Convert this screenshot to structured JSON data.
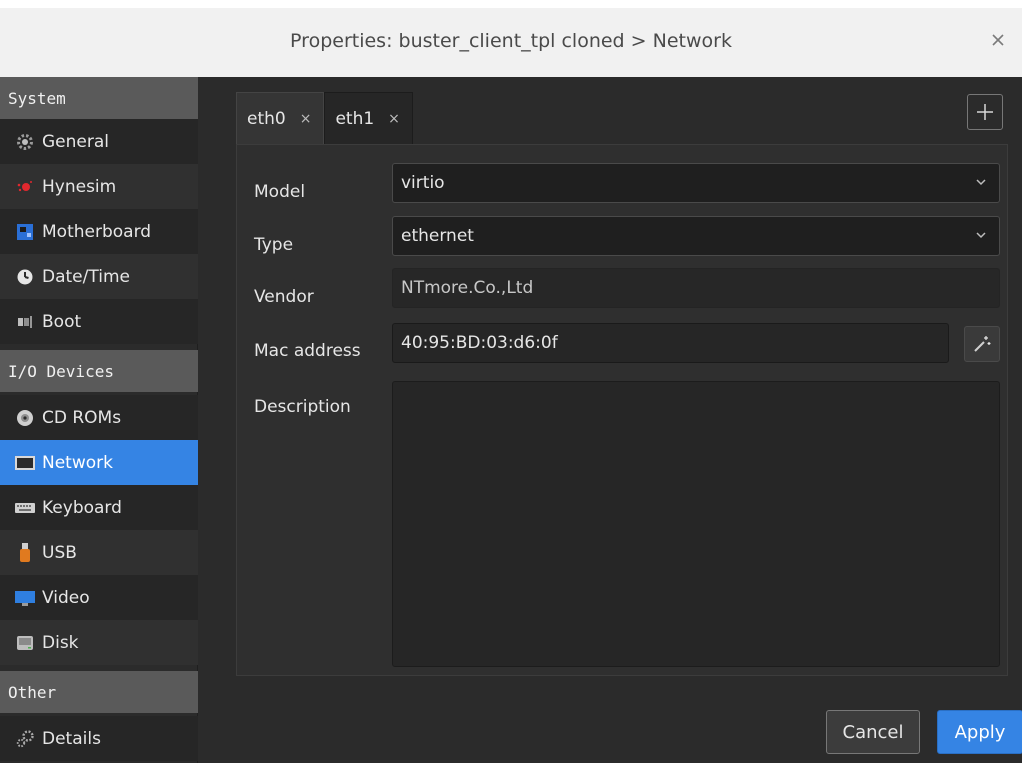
{
  "window": {
    "title": "Properties: buster_client_tpl cloned > Network",
    "close_symbol": "×"
  },
  "sidebar": {
    "sections": [
      {
        "header": "System",
        "items": [
          {
            "label": "General",
            "icon": "gear-icon"
          },
          {
            "label": "Hynesim",
            "icon": "hynesim-icon"
          },
          {
            "label": "Motherboard",
            "icon": "motherboard-icon"
          },
          {
            "label": "Date/Time",
            "icon": "clock-icon"
          },
          {
            "label": "Boot",
            "icon": "boot-icon"
          }
        ]
      },
      {
        "header": "I/O Devices",
        "items": [
          {
            "label": "CD ROMs",
            "icon": "cdrom-icon"
          },
          {
            "label": "Network",
            "icon": "network-icon",
            "selected": true
          },
          {
            "label": "Keyboard",
            "icon": "keyboard-icon"
          },
          {
            "label": "USB",
            "icon": "usb-icon"
          },
          {
            "label": "Video",
            "icon": "video-icon"
          },
          {
            "label": "Disk",
            "icon": "disk-icon"
          }
        ]
      },
      {
        "header": "Other",
        "items": [
          {
            "label": "Details",
            "icon": "details-gear-icon"
          }
        ]
      }
    ]
  },
  "tabs": [
    {
      "label": "eth0",
      "close": "×",
      "active": false
    },
    {
      "label": "eth1",
      "close": "×",
      "active": true
    }
  ],
  "add_tab_symbol": "+",
  "form": {
    "model": {
      "label": "Model",
      "value": "virtio"
    },
    "type": {
      "label": "Type",
      "value": "ethernet"
    },
    "vendor": {
      "label": "Vendor",
      "value": "NTmore.Co.,Ltd"
    },
    "mac": {
      "label": "Mac address",
      "value": "40:95:BD:03:d6:0f"
    },
    "description": {
      "label": "Description",
      "value": ""
    }
  },
  "buttons": {
    "cancel": "Cancel",
    "apply": "Apply"
  },
  "colors": {
    "accent": "#3584e4",
    "background": "#2b2b2b",
    "titlebar": "#f1f1f1"
  }
}
